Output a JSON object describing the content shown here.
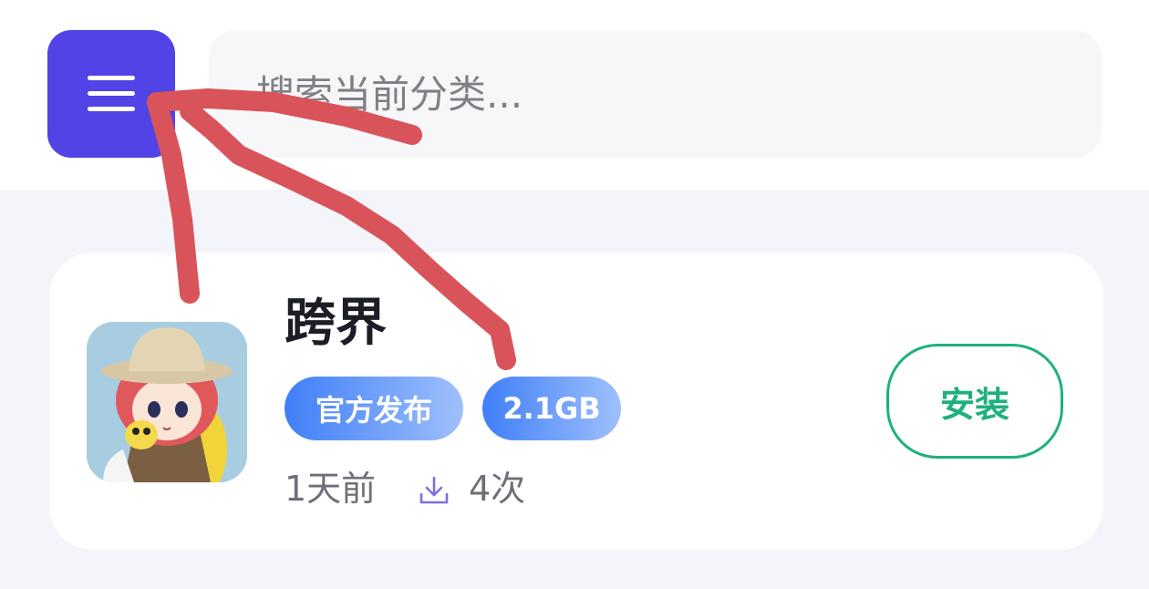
{
  "header": {
    "menu_icon": "hamburger-menu-icon",
    "search": {
      "placeholder": "搜索当前分类...",
      "value": ""
    }
  },
  "app": {
    "title": "跨界",
    "icon": "app-cover-image",
    "tags": [
      "官方发布",
      "2.1GB"
    ],
    "updated": "1天前",
    "download_icon": "download-icon",
    "downloads": "4次",
    "install_label": "安装"
  },
  "colors": {
    "menu_bg": "#5143e6",
    "tag_gradient_start": "#3f7ff7",
    "tag_gradient_end": "#9fc0fb",
    "install_green": "#1fb17b",
    "annotation_red": "#d9545a"
  }
}
